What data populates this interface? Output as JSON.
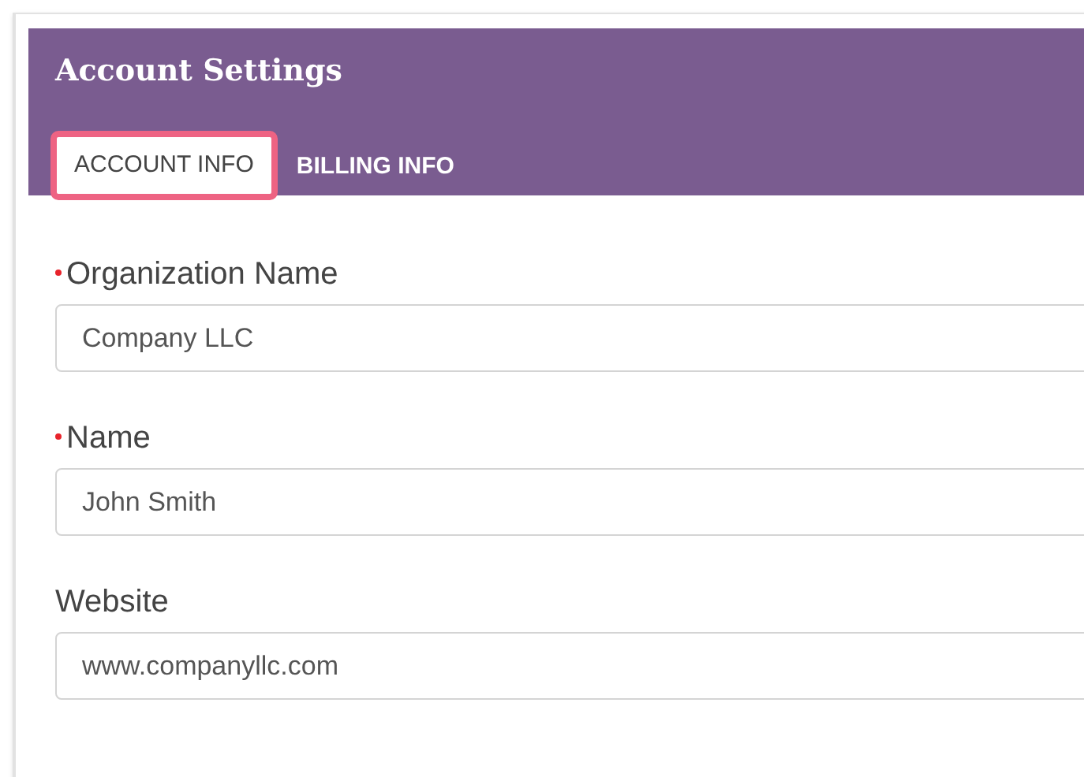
{
  "header": {
    "title": "Account Settings"
  },
  "tabs": [
    {
      "label": "ACCOUNT INFO",
      "selected": true
    },
    {
      "label": "BILLING INFO",
      "selected": false
    }
  ],
  "fields": [
    {
      "label": "Organization Name",
      "required": true,
      "value": "Company LLC"
    },
    {
      "label": "Name",
      "required": true,
      "value": "John Smith"
    },
    {
      "label": "Website",
      "required": false,
      "value": "www.companyllc.com"
    }
  ]
}
